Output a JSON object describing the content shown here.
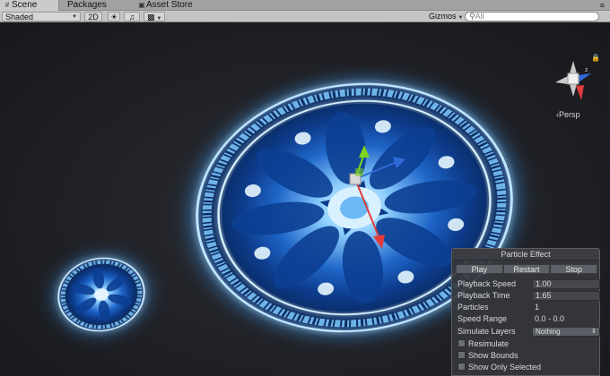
{
  "tabs": [
    {
      "label": "Scene",
      "icon": "grid-icon",
      "active": true
    },
    {
      "label": "Packages",
      "icon": "",
      "active": false
    },
    {
      "label": "Asset Store",
      "icon": "store-icon",
      "active": false
    }
  ],
  "toolbar": {
    "shading_mode": "Shaded",
    "mode_2d": "2D",
    "gizmos_label": "Gizmos",
    "search_placeholder": "All"
  },
  "scene": {
    "camera_label": "Persp",
    "gizmo_axes": [
      "z",
      "x",
      "y"
    ]
  },
  "particle_panel": {
    "title": "Particle Effect",
    "buttons": {
      "play": "Play",
      "restart": "Restart",
      "stop": "Stop"
    },
    "fields": {
      "playback_speed_label": "Playback Speed",
      "playback_speed_value": "1.00",
      "playback_time_label": "Playback Time",
      "playback_time_value": "1.65",
      "particles_label": "Particles",
      "particles_value": "1",
      "speed_range_label": "Speed Range",
      "speed_range_value": "0.0 - 0.0",
      "simulate_layers_label": "Simulate Layers",
      "simulate_layers_value": "Nothing"
    },
    "checkboxes": {
      "resimulate": "Resimulate",
      "show_bounds": "Show Bounds",
      "show_only_selected": "Show Only Selected"
    }
  },
  "colors": {
    "glow": "#6fc4ff",
    "glow_core": "#e8f6ff",
    "panel_bg": "#35373c",
    "axis_x": "#e03c3c",
    "axis_y": "#7ed321",
    "axis_z": "#2f6bd8"
  }
}
